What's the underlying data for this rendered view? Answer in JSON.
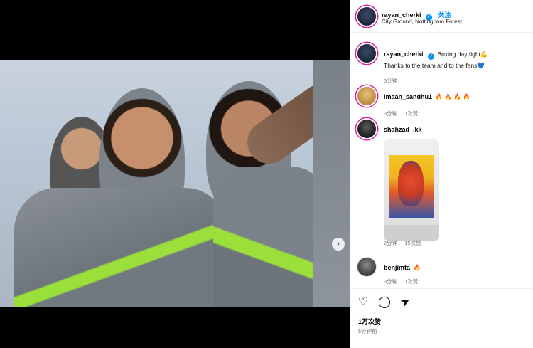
{
  "post": {
    "author": "rayan_cherki",
    "location": "City Ground, Nottingham Forest",
    "follow_label": "关注",
    "caption": {
      "username": "rayan_cherki",
      "line1": "Boxing day fight💪",
      "line2": "Thanks to the team and to the fans💙",
      "time": "5分钟"
    },
    "likes": "1万次赞",
    "time": "5分钟前"
  },
  "media": {
    "dots_count": 4,
    "next_glyph": "›"
  },
  "comments": [
    {
      "username": "imaan_sandhu1",
      "text": "🔥 🔥 🔥 🔥",
      "time": "3分钟",
      "likes": "1次赞"
    },
    {
      "username": "shahzad_.kk",
      "text": "",
      "time": "2分钟",
      "likes": "15次赞"
    },
    {
      "username": "benjimta",
      "text": "🔥",
      "time": "3分钟",
      "likes": "1次赞"
    }
  ],
  "icons": {
    "like": "♡",
    "comment": "◯",
    "share": "➤",
    "verified": "✓"
  },
  "colors": {
    "accent": "#0095f6",
    "kit_green": "#9be03a",
    "kit_grey": "#7d848c"
  }
}
